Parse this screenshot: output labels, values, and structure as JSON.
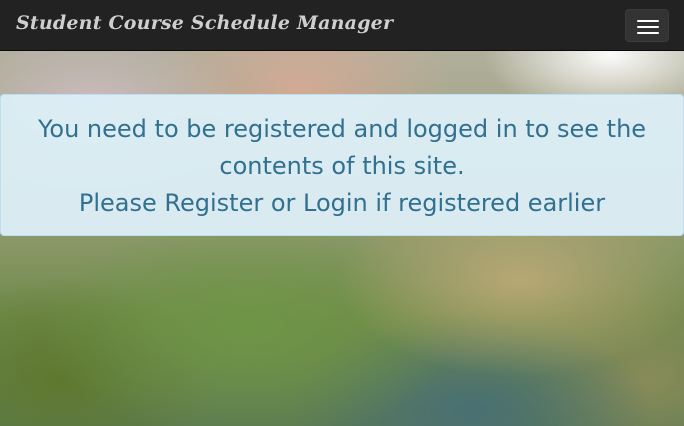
{
  "navbar": {
    "brand": "Student Course Schedule Manager",
    "toggle_icon": "hamburger-menu-icon"
  },
  "alert": {
    "message": "You need to be registered and logged in to see the contents of this site.",
    "instruction": "Please Register or Login if registered earlier"
  },
  "colors": {
    "navbar_bg": "#222222",
    "alert_bg": "#d9edf7",
    "alert_text": "#31708f"
  }
}
